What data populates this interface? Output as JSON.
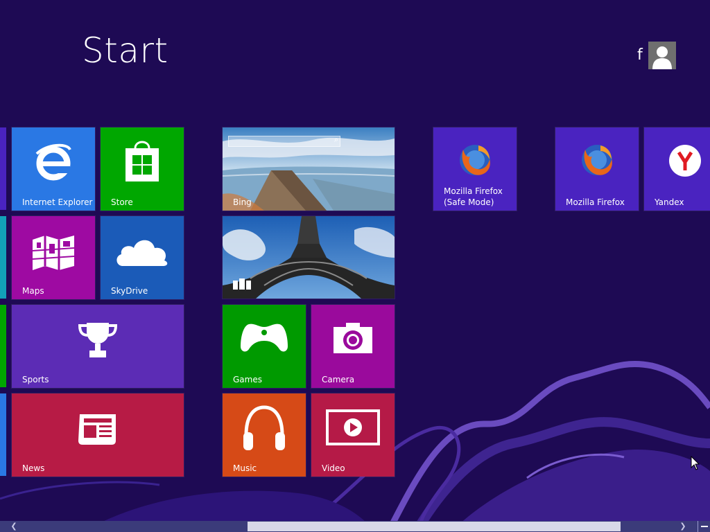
{
  "screen": {
    "title": "Start",
    "user_name": "f"
  },
  "tiles": {
    "internet_explorer": "Internet Explorer",
    "store": "Store",
    "maps": "Maps",
    "skydrive": "SkyDrive",
    "sports": "Sports",
    "news": "News",
    "bing": "Bing",
    "games": "Games",
    "camera": "Camera",
    "music": "Music",
    "video": "Video",
    "firefox_safe": "Mozilla Firefox\n(Safe Mode)",
    "firefox": "Mozilla Firefox",
    "yandex": "Yandex"
  },
  "colors": {
    "background": "#1e0a54",
    "internet_explorer": "#2a78e4",
    "store": "#00a700",
    "maps": "#9e0aa2",
    "skydrive": "#1b5bb8",
    "sports": "#5c2cb5",
    "news": "#b71b45",
    "games": "#009a00",
    "camera": "#9a0a9c",
    "music": "#d64a17",
    "video": "#b51a47",
    "desktop_app": "#4a23c0"
  }
}
